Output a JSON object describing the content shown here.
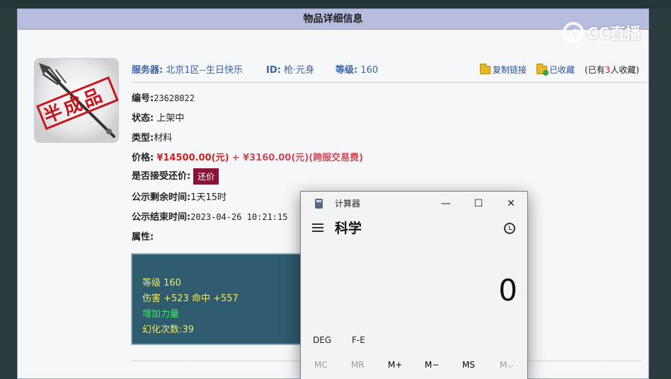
{
  "panel": {
    "title": "物品详细信息"
  },
  "logo": {
    "text": "CC直播"
  },
  "item": {
    "stamp_text": "半成品",
    "server_label": "服务器:",
    "server_value": "北京1区--生日快乐",
    "id_label": "ID:",
    "id_value": "枪·元身",
    "level_label": "等级:",
    "level_value": "160",
    "copy_link": "复制链接",
    "favorited": "已收藏",
    "fav_prefix": "(已有",
    "fav_count": "3",
    "fav_suffix": "人收藏)",
    "number_label": "编号:",
    "number_value": "23628022",
    "status_label": "状态:",
    "status_value": "上架中",
    "type_label": "类型:",
    "type_value": "材料",
    "price_label": "价格:",
    "price_value": "¥14500.00(元)",
    "fee_value": "+ ¥3160.00(元)(跨服交易费)",
    "counter_label": "是否接受还价:",
    "counter_button": "还价",
    "remain_label": "公示剩余时间:",
    "remain_value": "1天15时",
    "end_label": "公示结束时间:",
    "end_value": "2023-04-26 10:21:15",
    "attr_label": "属性:",
    "attrs": {
      "level": "等级 160",
      "damage": "伤害 +523 命中 +557",
      "strength": "增加力量",
      "illusion": "幻化次数:39"
    }
  },
  "calculator": {
    "app_title": "计算器",
    "mode": "科学",
    "display": "0",
    "deg": "DEG",
    "fe": "F-E",
    "mc": "MC",
    "mr": "MR",
    "mplus": "M+",
    "mminus": "M−",
    "ms": "MS",
    "mv": "M⌵",
    "minimize": "—",
    "maximize": "☐",
    "close": "✕"
  }
}
